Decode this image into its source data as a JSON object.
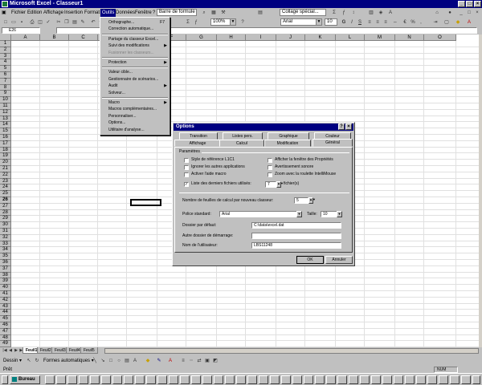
{
  "window": {
    "title": "Microsoft Excel - Classeur1"
  },
  "menu": [
    "Fichier",
    "Edition",
    "Affichage",
    "Insertion",
    "Format",
    "Outils",
    "Données",
    "Fenêtre",
    "?"
  ],
  "toolbar": {
    "formula_bar_label": "Barre de formule",
    "zoom": "100%",
    "font": "Arial",
    "size": "10",
    "paste_special": "Collage spécial..."
  },
  "namebox": "E26",
  "columns": [
    "A",
    "B",
    "C",
    "D",
    "E",
    "F",
    "G",
    "H",
    "I",
    "J",
    "K",
    "L",
    "M",
    "N",
    "O"
  ],
  "rows": [
    "1",
    "2",
    "3",
    "4",
    "5",
    "6",
    "7",
    "8",
    "9",
    "10",
    "11",
    "12",
    "13",
    "14",
    "15",
    "16",
    "17",
    "18",
    "19",
    "20",
    "21",
    "22",
    "23",
    "24",
    "25",
    "26",
    "27",
    "28",
    "29",
    "30",
    "31",
    "32",
    "33",
    "34",
    "35",
    "36",
    "37",
    "38",
    "39",
    "40",
    "41",
    "42",
    "43",
    "44",
    "45",
    "46",
    "47",
    "48",
    "49"
  ],
  "outils_menu": [
    {
      "label": "Orthographe...",
      "shortcut": "F7"
    },
    {
      "label": "Correction automatique..."
    },
    {
      "sep": true
    },
    {
      "label": "Partage du classeur Excel..."
    },
    {
      "label": "Suivi des modifications",
      "submenu": true
    },
    {
      "label": "Fusionner les classeurs...",
      "disabled": true
    },
    {
      "sep": true
    },
    {
      "label": "Protection",
      "submenu": true
    },
    {
      "sep": true
    },
    {
      "label": "Valeur cible..."
    },
    {
      "label": "Gestionnaire de scénarios..."
    },
    {
      "label": "Audit",
      "submenu": true
    },
    {
      "label": "Solveur..."
    },
    {
      "sep": true
    },
    {
      "label": "Macro",
      "submenu": true
    },
    {
      "label": "Macros complémentaires..."
    },
    {
      "label": "Personnaliser..."
    },
    {
      "label": "Options..."
    },
    {
      "label": "Utilitaire d'analyse..."
    }
  ],
  "dialog": {
    "title": "Options",
    "tabs_back": [
      "Transition",
      "Listes pers.",
      "Graphique",
      "Couleur"
    ],
    "tabs_front": [
      "Affichage",
      "Calcul",
      "Modification",
      "Général"
    ],
    "group": "Paramètres",
    "checks": [
      {
        "label": "Style de référence L1C1",
        "checked": false
      },
      {
        "label": "Afficher la fenêtre des Propriétés",
        "checked": false
      },
      {
        "label": "Ignorer les autres applications",
        "checked": false
      },
      {
        "label": "Avertissement sonore",
        "checked": false
      },
      {
        "label": "Activer l'aide macro",
        "checked": false
      },
      {
        "label": "Zoom avec la roulette IntelliMouse",
        "checked": false
      }
    ],
    "recent_files_label": "Liste des derniers fichiers utilisés:",
    "recent_files_value": "7",
    "recent_files_unit": "fichier(s)",
    "sheets_label": "Nombre de feuilles de calcul par nouveau classeur:",
    "sheets_value": "5",
    "font_label": "Police standard:",
    "font_value": "Arial",
    "size_label": "Taille:",
    "size_value": "10",
    "default_folder_label": "Dossier par défaut:",
    "default_folder_value": "C:\\data\\excel.dat",
    "alt_start_label": "Autre dossier de démarrage:",
    "alt_start_value": "",
    "username_label": "Nom de l'utilisateur:",
    "username_value": "LBS11248",
    "ok": "OK",
    "cancel": "Annuler"
  },
  "sheets": [
    "Feuil1",
    "Feuil2",
    "Feuil3",
    "Feuil4",
    "Feuil5"
  ],
  "drawbar": {
    "dessin": "Dessin",
    "formes": "Formes automatiques"
  },
  "status": {
    "left": "Prêt",
    "num": "NUM"
  },
  "taskbar": {
    "start": "Bureau"
  }
}
